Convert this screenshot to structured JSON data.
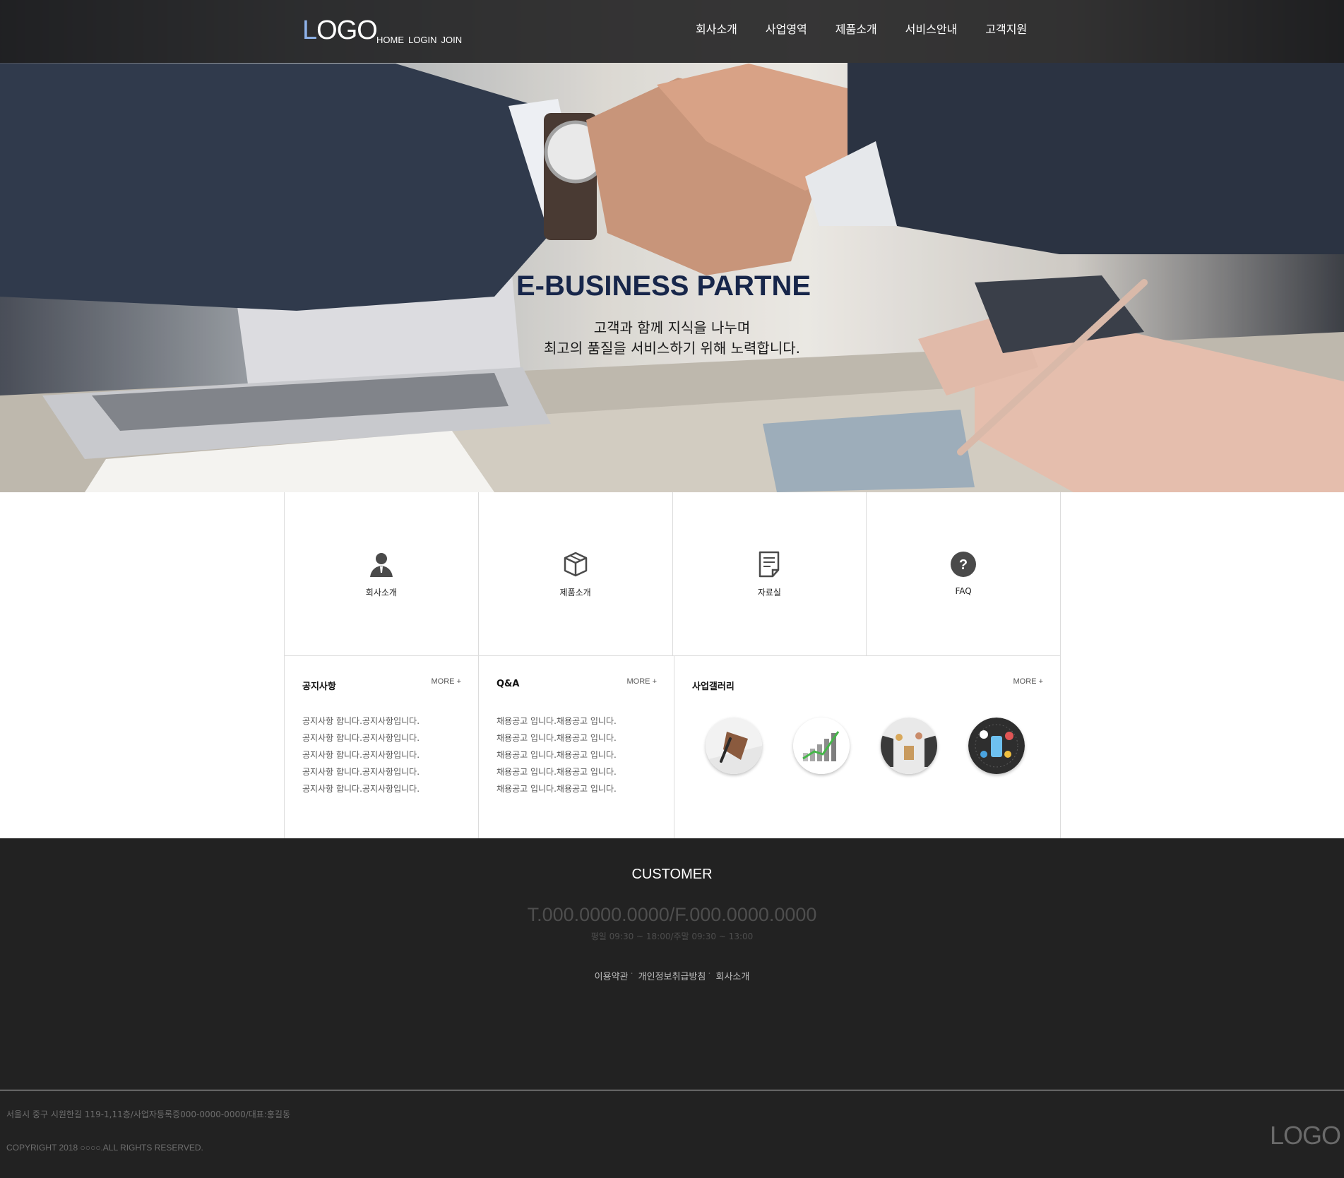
{
  "header": {
    "logo": {
      "first_letter": "L",
      "rest": "OGO"
    },
    "top_links": [
      "HOME",
      "LOGIN",
      "JOIN"
    ],
    "nav": [
      "회사소개",
      "사업영역",
      "제품소개",
      "서비스안내",
      "고객지원"
    ]
  },
  "hero": {
    "title": "E-BUSINESS PARTNE",
    "subtitle_line1": "고객과 함께 지식을 나누며",
    "subtitle_line2": "최고의 품질을 서비스하기 위해 노력합니다."
  },
  "quick_menu": [
    {
      "label": "회사소개",
      "icon": "person-icon"
    },
    {
      "label": "제품소개",
      "icon": "box-icon"
    },
    {
      "label": "자료실",
      "icon": "document-icon"
    },
    {
      "label": "FAQ",
      "icon": "question-icon"
    }
  ],
  "boards": {
    "notice": {
      "title": "공지사항",
      "more": "MORE +",
      "items": [
        "공지사항 합니다.공지사항입니다.",
        "공지사항 합니다.공지사항입니다.",
        "공지사항 합니다.공지사항입니다.",
        "공지사항 합니다.공지사항입니다.",
        "공지사항 합니다.공지사항입니다."
      ]
    },
    "qna": {
      "title": "Q&A",
      "more": "MORE +",
      "items": [
        "채용공고 입니다.채용공고 입니다.",
        "채용공고 입니다.채용공고 입니다.",
        "채용공고 입니다.채용공고 입니다.",
        "채용공고 입니다.채용공고 입니다.",
        "채용공고 입니다.채용공고 입니다."
      ]
    },
    "gallery": {
      "title": "사업갤러리",
      "more": "MORE +",
      "thumbs": [
        "pen-writing-thumb",
        "growth-chart-thumb",
        "shopping-hands-thumb",
        "mobile-devices-thumb"
      ]
    }
  },
  "footer": {
    "title": "CUSTOMER",
    "phone": "T.000.0000.0000/F.000.0000.0000",
    "hours": "평일 09:30 ~ 18:00/주말 09:30 ~ 13:00",
    "links": [
      "이용약관",
      "개인정보취급방침",
      "회사소개"
    ],
    "link_separator": "·",
    "address": "서울시 중구 시원한길 119-1,11층/사업자등록증000-0000-0000/대표:홍길동",
    "copyright": "COPYRIGHT 2018 ○○○○.ALL RIGHTS RESERVED.",
    "logo": "LOGO"
  },
  "colors": {
    "topbar": "#1c1c1e",
    "logo_accent": "#8fb3ea",
    "hero_title": "#17264a",
    "footer_bg": "#222222",
    "border": "#dcdcdc"
  }
}
